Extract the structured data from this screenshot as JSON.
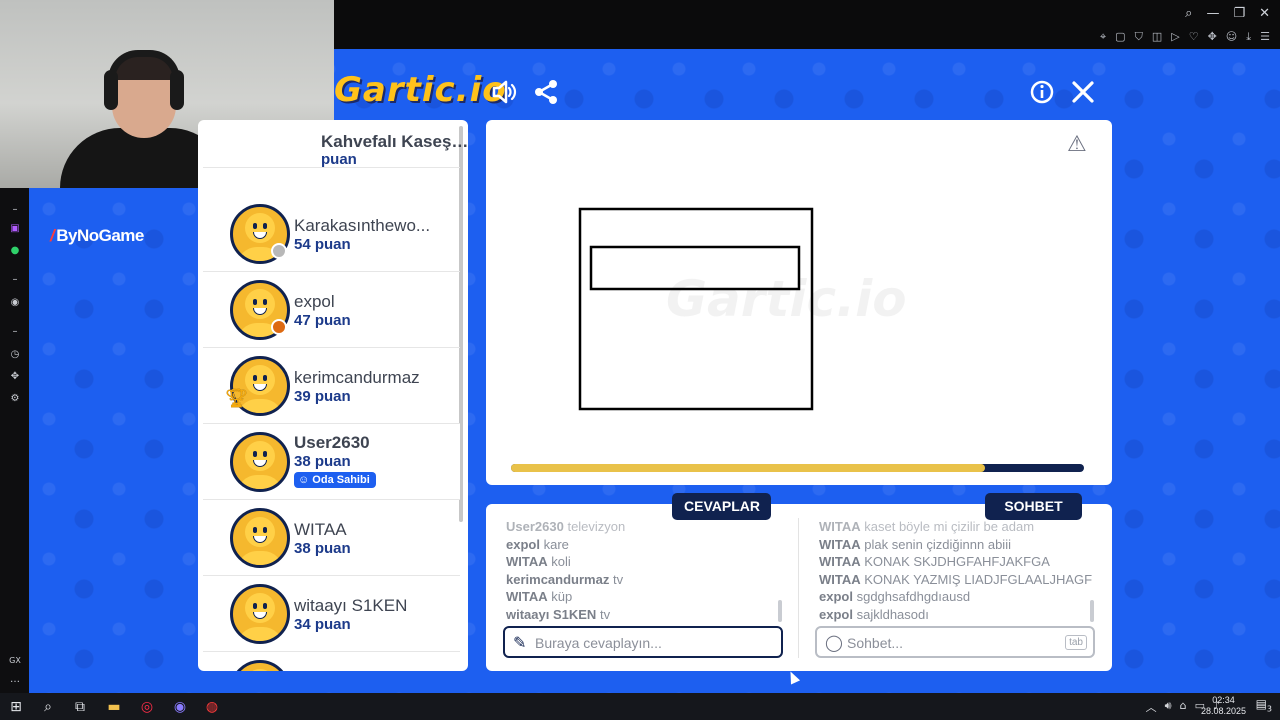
{
  "browser": {
    "window_controls": [
      "search-icon",
      "minimize-icon",
      "restore-icon",
      "close-icon"
    ],
    "extensions": [
      "pin-icon",
      "snapshot-icon",
      "shield-icon",
      "box-icon",
      "play-icon",
      "heart-icon",
      "puzzle-icon",
      "user-icon",
      "download-icon",
      "menu-icon"
    ]
  },
  "brand": {
    "logo_text": "Gartic.io",
    "sponsor": "ByNoGame",
    "accent": "#1d5ff0",
    "navy": "#10224f",
    "yellow": "#e9c24a"
  },
  "players": [
    {
      "name": "Kahvefalı Kaseşeği",
      "points": "puan",
      "partial": true
    },
    {
      "name": "Karakasınthewo...",
      "points": "54 puan",
      "status_color": "#b8b8b8"
    },
    {
      "name": "expol",
      "points": "47 puan",
      "status_color": "#dd6a12"
    },
    {
      "name": "kerimcandurmaz",
      "points": "39 puan",
      "trophy": "1"
    },
    {
      "name": "User2630",
      "points": "38 puan",
      "badge": "Oda Sahibi",
      "self": true
    },
    {
      "name": "WITAA",
      "points": "38 puan"
    },
    {
      "name": "witaayı S1KEN",
      "points": "34 puan"
    }
  ],
  "canvas": {
    "progress_fraction": 0.828,
    "warning_icon": "warning-triangle-icon"
  },
  "tabs": {
    "answers": "CEVAPLAR",
    "chat": "SOHBET"
  },
  "answers_log": [
    {
      "user": "User2630",
      "text": "televizyon"
    },
    {
      "user": "expol",
      "text": "kare"
    },
    {
      "user": "WITAA",
      "text": "koli"
    },
    {
      "user": "kerimcandurmaz",
      "text": "tv"
    },
    {
      "user": "WITAA",
      "text": "küp"
    },
    {
      "user": "witaayı S1KEN",
      "text": "tv"
    }
  ],
  "chat_log": [
    {
      "user": "WITAA",
      "text": "kaset böyle mi çizilir be adam"
    },
    {
      "user": "WITAA",
      "text": "plak senin çizdiğinnn abiii"
    },
    {
      "user": "WITAA",
      "text": "KONAK SKJDHGFAHFJAKFGA"
    },
    {
      "user": "WITAA",
      "text": "KONAK YAZMIŞ LIADJFGLAALJHAGF"
    },
    {
      "user": "expol",
      "text": "sgdghsafdhgdıausd"
    },
    {
      "user": "expol",
      "text": "sajkldhasodı"
    }
  ],
  "inputs": {
    "answer_placeholder": "Buraya cevaplayın...",
    "chat_placeholder": "Sohbet...",
    "chat_key_hint": "tab"
  },
  "taskbar": {
    "time": "02:34",
    "date": "28.08.2025",
    "notifications": "3"
  }
}
